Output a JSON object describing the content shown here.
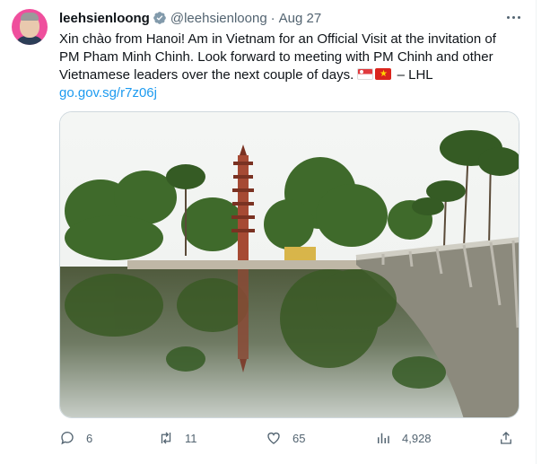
{
  "tweet": {
    "author_name": "leehsienloong",
    "handle": "@leehsienloong",
    "separator": "·",
    "date": "Aug 27",
    "text_line1": "Xin chào from Hanoi! Am in Vietnam for an Official Visit at the invitation of",
    "text_line2": "PM Pham Minh Chinh. Look forward to meeting with PM Chinh and other",
    "text_line3": "Vietnamese leaders over the next couple of days.",
    "text_sign": " – LHL",
    "link": "go.gov.sg/r7z06j",
    "flags": [
      "singapore-flag",
      "vietnam-flag"
    ]
  },
  "actions": {
    "replies": "6",
    "reposts": "11",
    "likes": "65",
    "views": "4,928"
  },
  "colors": {
    "accent": "#1d9bf0",
    "text": "#0f1419",
    "secondary": "#536471",
    "avatar_bg": "#ef4f9d"
  },
  "icons": [
    "verified-badge-icon",
    "more-icon",
    "reply-icon",
    "repost-icon",
    "like-icon",
    "views-icon",
    "share-icon"
  ]
}
